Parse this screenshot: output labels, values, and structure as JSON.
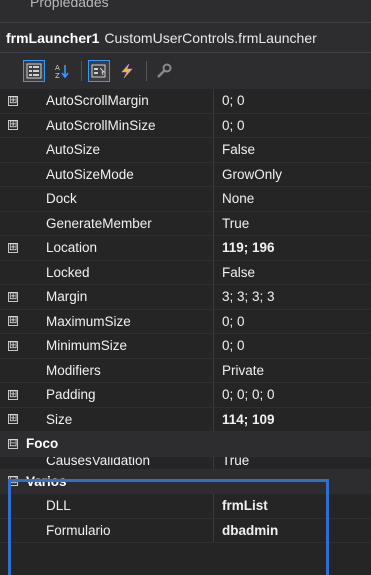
{
  "panel": {
    "title": "Propiedades"
  },
  "object_selector": {
    "name": "frmLauncher1",
    "type": "CustomUserControls.frmLauncher"
  },
  "toolbar": {
    "buttons": [
      {
        "icon": "categorized-icon"
      },
      {
        "icon": "alphabetical-icon"
      },
      {
        "icon": "properties-icon"
      },
      {
        "icon": "events-icon"
      },
      {
        "icon": "property-pages-icon"
      }
    ]
  },
  "properties": [
    {
      "name": "AutoScrollMargin",
      "value": "0; 0",
      "expander": "⊞"
    },
    {
      "name": "AutoScrollMinSize",
      "value": "0; 0",
      "expander": "⊞"
    },
    {
      "name": "AutoSize",
      "value": "False"
    },
    {
      "name": "AutoSizeMode",
      "value": "GrowOnly"
    },
    {
      "name": "Dock",
      "value": "None"
    },
    {
      "name": "GenerateMember",
      "value": "True"
    },
    {
      "name": "Location",
      "value": "119; 196",
      "expander": "⊞"
    },
    {
      "name": "Locked",
      "value": "False"
    },
    {
      "name": "Margin",
      "value": "3; 3; 3; 3",
      "expander": "⊞"
    },
    {
      "name": "MaximumSize",
      "value": "0; 0",
      "expander": "⊞"
    },
    {
      "name": "MinimumSize",
      "value": "0; 0",
      "expander": "⊞"
    },
    {
      "name": "Modifiers",
      "value": "Private"
    },
    {
      "name": "Padding",
      "value": "0; 0; 0; 0",
      "expander": "⊞"
    },
    {
      "name": "Size",
      "value": "114; 109",
      "expander": "⊞"
    }
  ],
  "category_foco": {
    "name": "Foco",
    "expander": "⊟"
  },
  "foco_partial": {
    "name": "CausesValidation",
    "value": "True"
  },
  "category_varios": {
    "name": "Varios",
    "expander": "⊟"
  },
  "varios": [
    {
      "name": "DLL",
      "value": "frmList"
    },
    {
      "name": "Formulario",
      "value": "dbadmin"
    }
  ],
  "colors": {
    "highlight": "#2e6fd1",
    "active_button": "#3399ff"
  }
}
